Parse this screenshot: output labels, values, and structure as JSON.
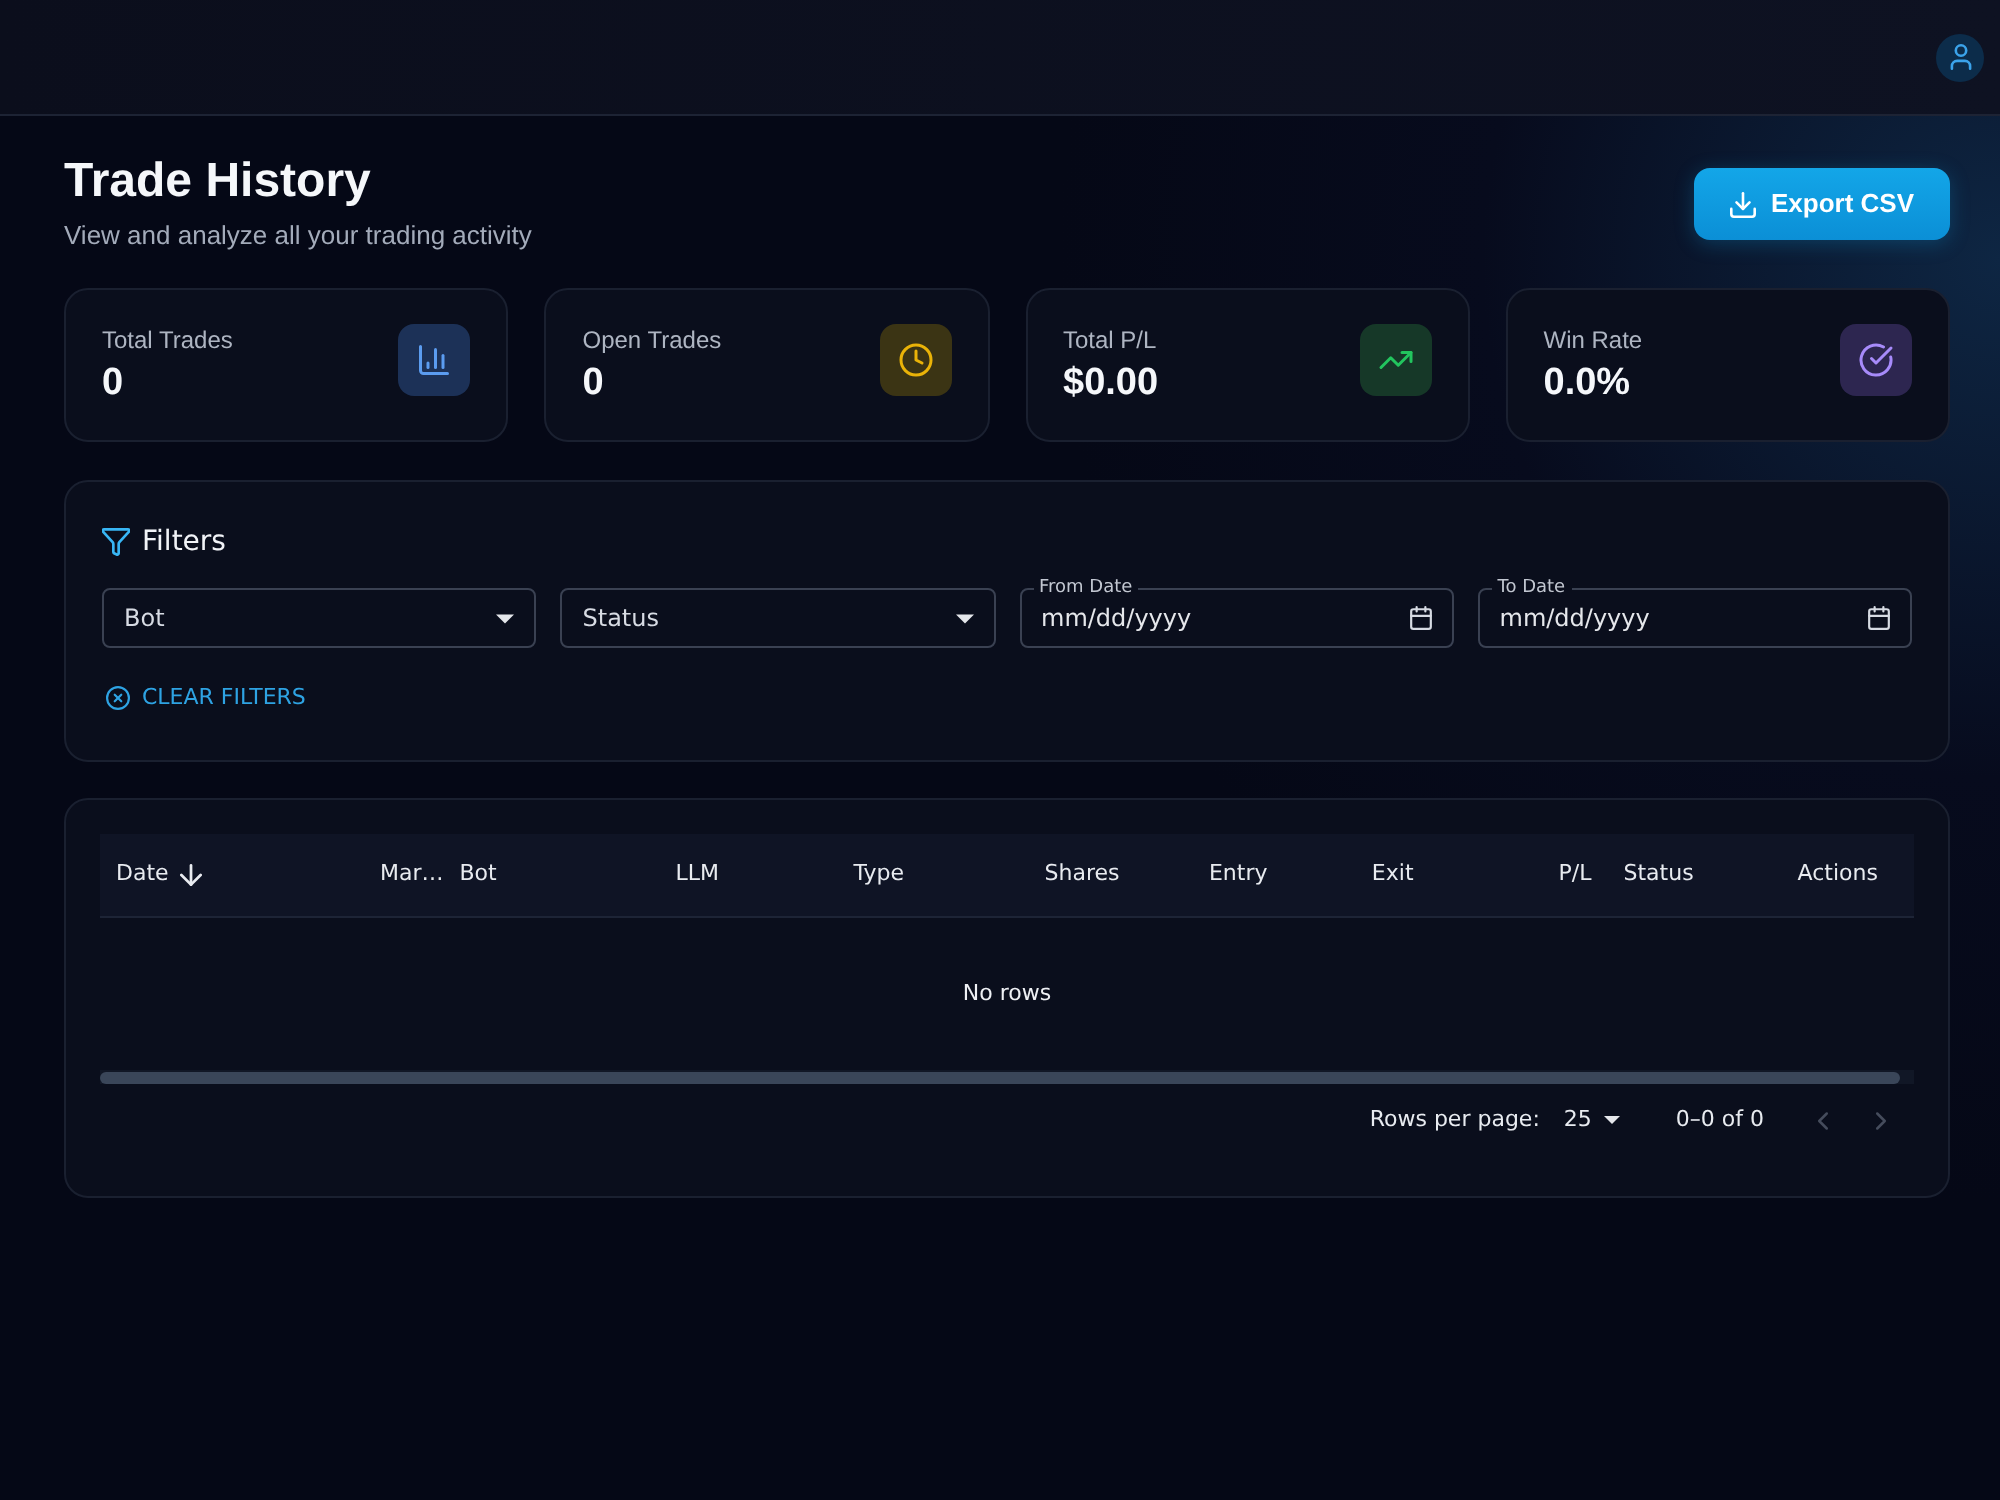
{
  "page": {
    "title": "Trade History",
    "subtitle": "View and analyze all your trading activity",
    "export_button": "Export CSV"
  },
  "stats": [
    {
      "label": "Total Trades",
      "value": "0",
      "kind": "chart"
    },
    {
      "label": "Open Trades",
      "value": "0",
      "kind": "clock"
    },
    {
      "label": "Total P/L",
      "value": "$0.00",
      "kind": "trend"
    },
    {
      "label": "Win Rate",
      "value": "0.0%",
      "kind": "check"
    }
  ],
  "filters": {
    "title": "Filters",
    "fields": [
      {
        "kind": "select",
        "label": "Bot"
      },
      {
        "kind": "select",
        "label": "Status"
      },
      {
        "kind": "date",
        "label": "From Date",
        "placeholder": "mm/dd/yyyy"
      },
      {
        "kind": "date",
        "label": "To Date",
        "placeholder": "mm/dd/yyyy"
      }
    ],
    "clear_button": "CLEAR FILTERS"
  },
  "table": {
    "columns": [
      {
        "label": "Date",
        "sorted": true
      },
      {
        "label": "Mar…",
        "sorted": false
      },
      {
        "label": "Bot",
        "sorted": false
      },
      {
        "label": "LLM",
        "sorted": false
      },
      {
        "label": "Type",
        "sorted": false
      },
      {
        "label": "Shares",
        "sorted": false
      },
      {
        "label": "Entry",
        "sorted": false
      },
      {
        "label": "Exit",
        "sorted": false
      },
      {
        "label": "P/L",
        "sorted": false
      },
      {
        "label": "Status",
        "sorted": false
      },
      {
        "label": "Actions",
        "sorted": false
      }
    ],
    "empty_message": "No rows",
    "pagination": {
      "rows_per_page_label": "Rows per page:",
      "rows_per_page": "25",
      "range": "0–0 of 0",
      "previous_disabled": true,
      "next_disabled": true
    }
  }
}
